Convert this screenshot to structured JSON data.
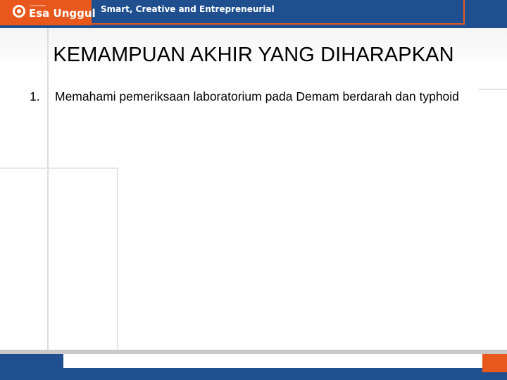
{
  "header": {
    "brand_small": "Universitas",
    "brand_name": "Esa Unggul",
    "tagline": "Smart, Creative and Entrepreneurial"
  },
  "colors": {
    "brand_blue": "#1f4f8f",
    "brand_orange": "#e8581c"
  },
  "slide": {
    "title": "KEMAMPUAN AKHIR YANG DIHARAPKAN",
    "items": [
      {
        "number": "1.",
        "text": "Memahami pemeriksaan  laboratorium pada Demam berdarah dan typhoid"
      }
    ]
  }
}
